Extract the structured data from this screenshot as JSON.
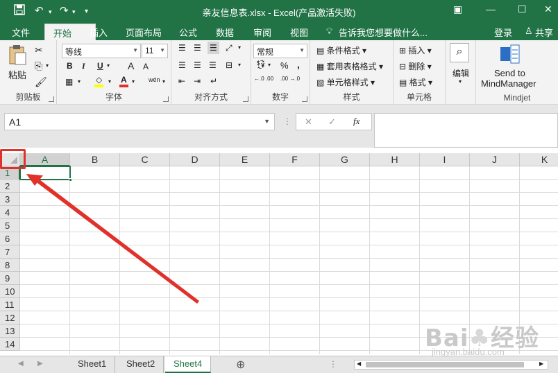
{
  "titlebar": {
    "title": "亲友信息表.xlsx - Excel(产品激活失败)",
    "save_icon": "save-icon",
    "undo_icon": "undo-icon",
    "redo_icon": "redo-icon",
    "customize_icon": "customize-icon"
  },
  "tabs": [
    "文件",
    "开始",
    "插入",
    "页面布局",
    "公式",
    "数据",
    "审阅",
    "视图"
  ],
  "active_tab": "开始",
  "tell_me": "告诉我您想要做什么...",
  "login": "登录",
  "share": "共享",
  "ribbon": {
    "clipboard": {
      "paste": "粘贴",
      "label": "剪贴板"
    },
    "font": {
      "name": "等线",
      "size": "11",
      "bold": "B",
      "italic": "I",
      "underline": "U",
      "grow": "A",
      "shrink": "A",
      "wen": "wén",
      "font_color": "A",
      "label": "字体"
    },
    "align": {
      "label": "对齐方式"
    },
    "number": {
      "format": "常规",
      "percent": "%",
      "comma": ",",
      "inc": "←.0 .00",
      "dec": ".00 →.0",
      "label": "数字"
    },
    "styles": {
      "cond": "条件格式",
      "table": "套用表格格式",
      "cell": "单元格样式",
      "label": "样式"
    },
    "cells": {
      "insert": "插入",
      "delete": "删除",
      "format": "格式",
      "label": "单元格"
    },
    "editing": {
      "label": "编辑"
    },
    "mindjet": {
      "send": "Send to",
      "target": "MindManager",
      "label": "Mindjet"
    }
  },
  "formula": {
    "name_box": "A1",
    "cancel": "✕",
    "enter": "✓",
    "fx": "fx",
    "value": ""
  },
  "columns": [
    "A",
    "B",
    "C",
    "D",
    "E",
    "F",
    "G",
    "H",
    "I",
    "J",
    "K"
  ],
  "rows": [
    "1",
    "2",
    "3",
    "4",
    "5",
    "6",
    "7",
    "8",
    "9",
    "10",
    "11",
    "12",
    "13",
    "14"
  ],
  "selected_cell": "A1",
  "sheets": [
    "Sheet1",
    "Sheet2",
    "Sheet4"
  ],
  "active_sheet": "Sheet4",
  "add_sheet": "⊕",
  "watermark": {
    "logo": "Baidu经验",
    "url": "jingyan.baidu.com"
  },
  "colors": {
    "accent": "#217346",
    "annotation": "#e0312a"
  }
}
